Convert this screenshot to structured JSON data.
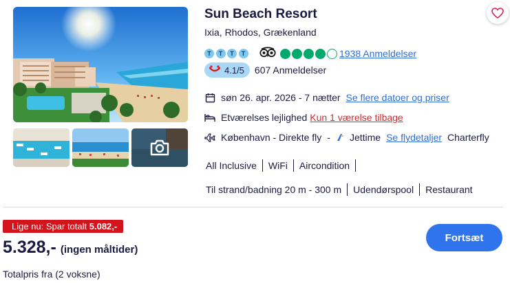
{
  "hotel": {
    "name": "Sun Beach Resort",
    "location": "Ixia, Rhodos, Grækenland",
    "tui_rating_letters": [
      "T",
      "T",
      "T",
      "T"
    ],
    "tripadvisor": {
      "filled": 4,
      "total": 5,
      "reviews_label": "1938 Anmeldelser"
    },
    "tui_score": {
      "logo": "tui",
      "value": "4.1/5",
      "reviews_label": "607 Anmeldelser"
    }
  },
  "details": {
    "date_text": "søn 26. apr. 2026 - 7 nætter",
    "date_link": "Se flere datoer og priser",
    "room_text": "Etværelses lejlighed",
    "room_availability": "Kun 1 værelse tilbage",
    "flight_text": "København - Direkte fly",
    "flight_dash": "-",
    "flight_duration": "Jettime",
    "flight_link": "Se flydetaljer",
    "flight_type": "Charterfly"
  },
  "facilities_row1": [
    "All Inclusive",
    "WiFi",
    "Aircondition"
  ],
  "facilities_row2": [
    "Til strand/badning 20 m - 300 m",
    "Udendørspool",
    "Restaurant"
  ],
  "pricing": {
    "deal_prefix": "Lige nu: Spar totalt",
    "deal_amount": "5.082,-",
    "price": "5.328,-",
    "meal_note": "(ingen måltider)",
    "total_label": "Totalpris fra (2 voksne)"
  },
  "actions": {
    "continue_label": "Fortsæt"
  },
  "colors": {
    "primary_button": "#2f74ec",
    "deal_red": "#d4141c",
    "tripadvisor_green": "#00aa6c",
    "link_blue": "#2c6fd6",
    "navy_text": "#1a1a40"
  },
  "icons": [
    "heart-icon",
    "calendar-icon",
    "bed-icon",
    "plane-icon",
    "camera-icon",
    "tripadvisor-owl-icon",
    "tui-logo-icon",
    "jettime-logo-icon"
  ]
}
